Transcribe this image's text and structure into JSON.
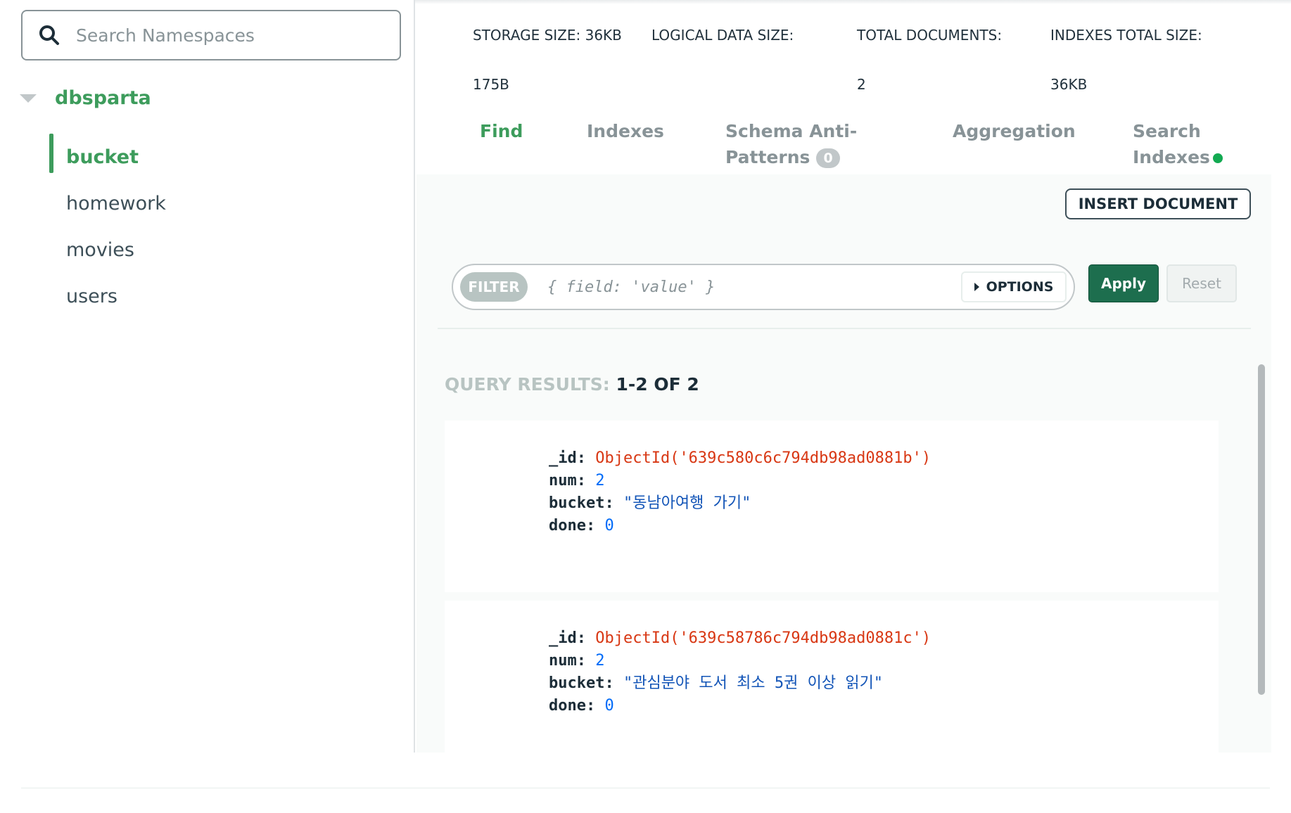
{
  "sidebar": {
    "search_placeholder": "Search Namespaces",
    "database": "dbsparta",
    "collections": [
      "bucket",
      "homework",
      "movies",
      "users"
    ]
  },
  "stats": {
    "storage_label": "STORAGE SIZE:",
    "storage_value": "36KB",
    "logical_label": "LOGICAL DATA SIZE:",
    "logical_value": "175B",
    "docs_label": "TOTAL DOCUMENTS:",
    "docs_value": "2",
    "indexes_label": "INDEXES TOTAL SIZE:",
    "indexes_value": "36KB"
  },
  "tabs": {
    "find": "Find",
    "indexes": "Indexes",
    "schema_line1": "Schema Anti-",
    "schema_line2": "Patterns",
    "schema_badge": "0",
    "aggregation": "Aggregation",
    "search_line1": "Search",
    "search_line2": "Indexes"
  },
  "toolbar": {
    "insert_label": "INSERT DOCUMENT",
    "filter_label": "FILTER",
    "filter_placeholder": "{ field: 'value' }",
    "options_label": "OPTIONS",
    "apply_label": "Apply",
    "reset_label": "Reset"
  },
  "results": {
    "label": "QUERY RESULTS:",
    "count": "1-2 OF 2"
  },
  "documents": [
    {
      "id_key": "_id:",
      "id_value": "ObjectId('639c580c6c794db98ad0881b')",
      "num_key": "num:",
      "num_value": "2",
      "bucket_key": "bucket:",
      "bucket_value": "\"동남아여행 가기\"",
      "done_key": "done:",
      "done_value": "0"
    },
    {
      "id_key": "_id:",
      "id_value": "ObjectId('639c58786c794db98ad0881c')",
      "num_key": "num:",
      "num_value": "2",
      "bucket_key": "bucket:",
      "bucket_value": "\"관심분야 도서 최소 5권 이상 읽기\"",
      "done_key": "done:",
      "done_value": "0"
    }
  ],
  "colors": {
    "brand_green": "#3d9c5c",
    "apply_green": "#1d6e4e",
    "objectid_red": "#d83713",
    "string_blue": "#1254b7"
  }
}
